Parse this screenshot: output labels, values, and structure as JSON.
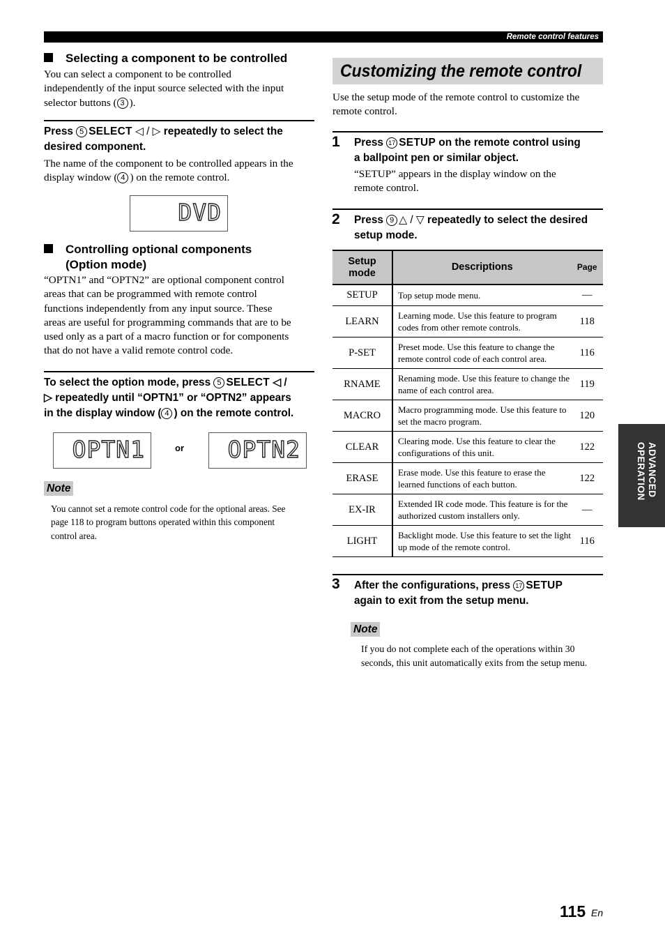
{
  "header": {
    "section_title": "Remote control features"
  },
  "left": {
    "section1": {
      "heading": "Selecting a component to be controlled",
      "body": [
        "You can select a component to be controlled",
        "independently of the input source selected with the input",
        "selector buttons (",
        "3",
        ")."
      ],
      "step": {
        "press": "Press ",
        "circle": "5",
        "key": "SELECT",
        "arrows": " ◁ / ▷ ",
        "rest1": "repeatedly to select the",
        "rest2": "desired component."
      },
      "step_body": [
        "The name of the component to be controlled appears in the",
        "display window (",
        "4",
        ") on the remote control."
      ],
      "display": "DVD"
    },
    "section2": {
      "heading_line1": "Controlling optional components",
      "heading_line2": "(Option mode)",
      "body": [
        "“OPTN1” and “OPTN2” are optional component control",
        "areas that can be programmed with remote control",
        "functions independently from any input source. These",
        "areas are useful for programming commands that are to be",
        "used only as a part of a macro function or for components",
        "that do not have a valid remote control code."
      ],
      "step": {
        "line1a": "To select the option mode, press ",
        "circle": "5",
        "key": "SELECT",
        "line1b": " ◁ /",
        "line2": "▷ repeatedly until “OPTN1” or “OPTN2” appears",
        "line3a": "in the display window (",
        "circle2": "4",
        "line3b": ") on the remote control."
      },
      "display1": "OPTN1",
      "or_label": "or",
      "display2": "OPTN2",
      "note_label": "Note",
      "note_lines": [
        "You cannot set a remote control code for the optional areas. See",
        "page 118 to program buttons operated within this component",
        "control area."
      ]
    }
  },
  "right": {
    "title": "Customizing the remote control",
    "intro": [
      "Use the setup mode of the remote control to customize the",
      "remote control."
    ],
    "step1": {
      "num": "1",
      "press": "Press ",
      "circle": "17",
      "key": "SETUP",
      "rest1": " on the remote control using",
      "rest2": "a ballpoint pen or similar object.",
      "body": [
        "“SETUP” appears in the display window on the",
        "remote control."
      ]
    },
    "step2": {
      "num": "2",
      "press": "Press ",
      "circle": "9",
      "arrows": "△ / ▽",
      "rest1": " repeatedly to select the desired",
      "rest2": "setup mode."
    },
    "table": {
      "headers": {
        "mode_line1": "Setup",
        "mode_line2": "mode",
        "desc": "Descriptions",
        "page": "Page"
      },
      "rows": [
        {
          "mode": "SETUP",
          "desc": "Top setup mode menu.",
          "page": "—"
        },
        {
          "mode": "LEARN",
          "desc": "Learning mode. Use this feature to program codes from other remote controls.",
          "page": "118"
        },
        {
          "mode": "P-SET",
          "desc": "Preset mode. Use this feature to change the remote control code of each control area.",
          "page": "116"
        },
        {
          "mode": "RNAME",
          "desc": "Renaming mode. Use this feature to change the name of each control area.",
          "page": "119"
        },
        {
          "mode": "MACRO",
          "desc": "Macro programming mode. Use this feature to set the macro program.",
          "page": "120"
        },
        {
          "mode": "CLEAR",
          "desc": "Clearing mode. Use this feature to clear the configurations of this unit.",
          "page": "122"
        },
        {
          "mode": "ERASE",
          "desc": "Erase mode. Use this feature to erase the learned functions of each button.",
          "page": "122"
        },
        {
          "mode": "EX-IR",
          "desc": "Extended IR code mode. This feature is for the authorized custom installers only.",
          "page": "—"
        },
        {
          "mode": "LIGHT",
          "desc": "Backlight mode. Use this feature to set the light up mode of the remote control.",
          "page": "116"
        }
      ]
    },
    "step3": {
      "num": "3",
      "rest1a": "After the configurations, press ",
      "circle": "17",
      "key": "SETUP",
      "rest2": "again to exit from the setup menu."
    },
    "note_label": "Note",
    "note_lines": [
      "If you do not complete each of the operations within 30",
      "seconds, this unit automatically exits from the setup menu."
    ]
  },
  "side_tab": {
    "line1": "ADVANCED",
    "line2": "OPERATION"
  },
  "footer": {
    "page_number": "115",
    "lang": "En"
  }
}
